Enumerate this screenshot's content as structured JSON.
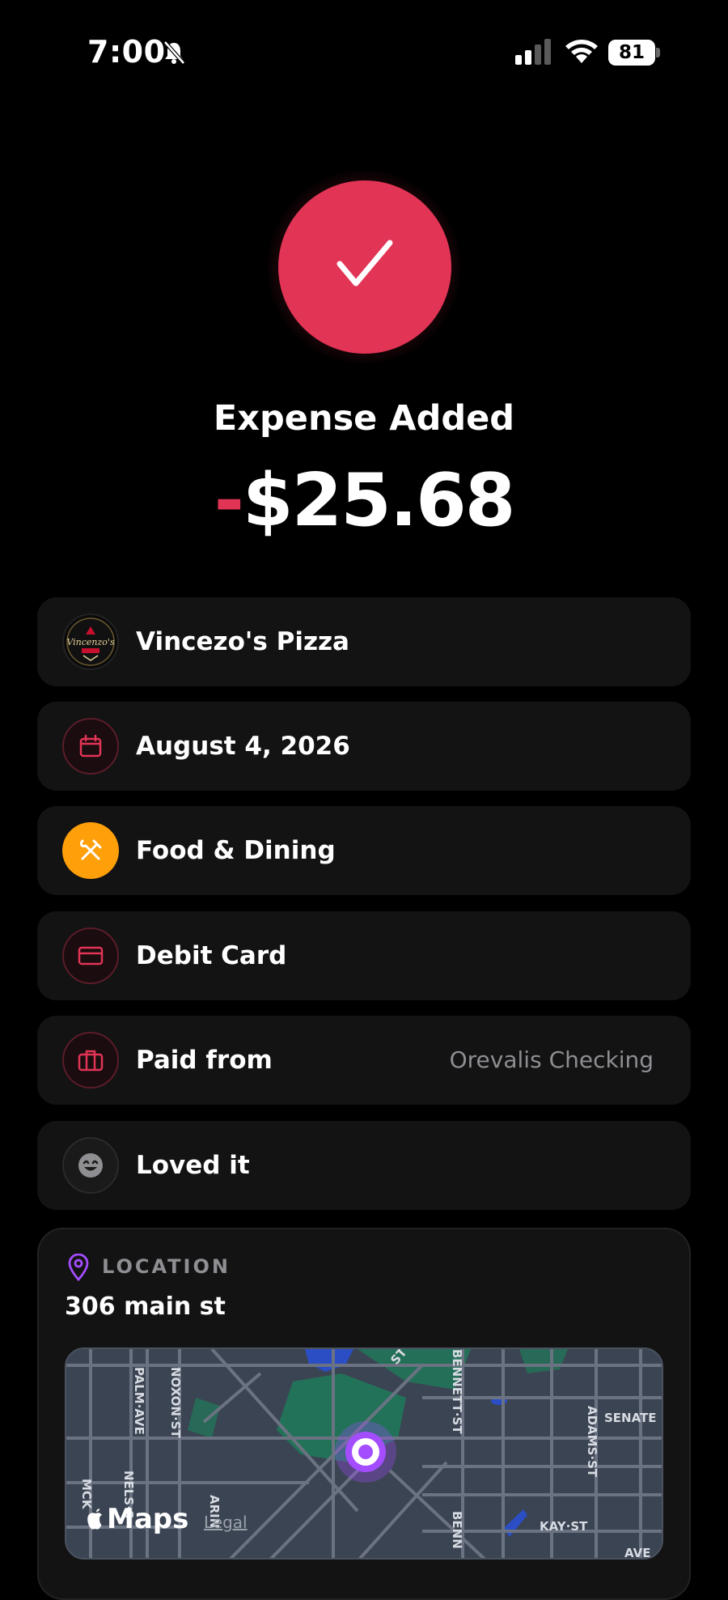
{
  "status_bar": {
    "time": "7:00",
    "battery": "81"
  },
  "header": {
    "title": "Expense Added",
    "amount_sign": "-",
    "amount_value": "$25.68"
  },
  "rows": [
    {
      "label": "Vincezo's Pizza",
      "icon": "restaurant-logo-icon"
    },
    {
      "label": "August 4, 2026",
      "icon": "calendar-icon"
    },
    {
      "label": "Food & Dining",
      "icon": "fork-knife-icon"
    },
    {
      "label": "Debit Card",
      "icon": "card-icon"
    },
    {
      "label": "Paid from",
      "value": "Orevalis Checking",
      "icon": "briefcase-icon"
    },
    {
      "label": "Loved it",
      "icon": "smile-icon"
    }
  ],
  "location": {
    "header": "LOCATION",
    "address": "306 main st",
    "maps_label": "Maps",
    "legal_label": "Legal",
    "streets": [
      "PALM·AVE",
      "NOXON·ST",
      "NELS·S",
      "MCK",
      "ARIN",
      "BENNETT·ST",
      "ADAMS·ST",
      "SENATE",
      "KAY·ST",
      "AVE",
      "ST",
      "BENN"
    ]
  },
  "colors": {
    "accent": "#e23455",
    "orange": "#ff9f0a",
    "pin": "#a34dff"
  }
}
